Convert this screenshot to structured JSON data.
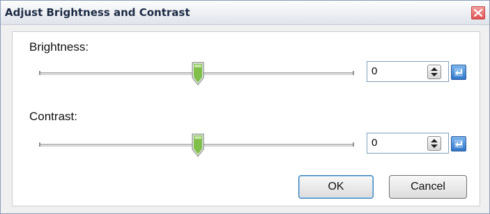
{
  "window": {
    "title": "Adjust Brightness and Contrast"
  },
  "brightness": {
    "label": "Brightness:",
    "value": "0",
    "slider_fraction": 0.5
  },
  "contrast": {
    "label": "Contrast:",
    "value": "0",
    "slider_fraction": 0.5
  },
  "buttons": {
    "ok_label": "OK",
    "cancel_label": "Cancel"
  },
  "icons": {
    "close": "close-icon",
    "spin": "spin-arrows-icon",
    "reset": "reset-icon",
    "thumb": "slider-thumb-icon"
  },
  "colors": {
    "close_button": "#e05050",
    "reset_button": "#2f74c9",
    "thumb": "#7fbf4a",
    "title_text": "#1c2a44"
  }
}
